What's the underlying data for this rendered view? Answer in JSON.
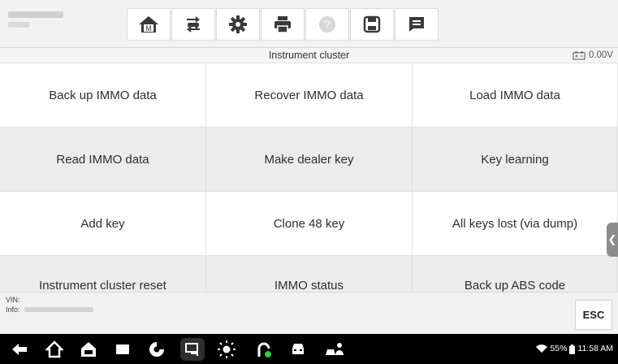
{
  "toolbar": {
    "buttons": [
      {
        "name": "home",
        "icon": "home-icon"
      },
      {
        "name": "vehicle-swap",
        "icon": "vehicle-swap-icon"
      },
      {
        "name": "settings",
        "icon": "gear-icon"
      },
      {
        "name": "print",
        "icon": "printer-icon"
      },
      {
        "name": "help",
        "icon": "help-icon"
      },
      {
        "name": "save",
        "icon": "save-icon"
      },
      {
        "name": "data-logging",
        "icon": "message-icon"
      }
    ],
    "home_badge": "M"
  },
  "titlebar": {
    "title": "Instrument cluster",
    "voltage": "0.00V"
  },
  "functions": [
    "Back up IMMO data",
    "Recover IMMO data",
    "Load IMMO data",
    "Read IMMO data",
    "Make dealer key",
    "Key learning",
    "Add key",
    "Clone 48 key",
    "All keys lost (via dump)",
    "Instrument cluster reset",
    "IMMO status",
    "Back up ABS code"
  ],
  "infobar": {
    "vin_label": "VIN:",
    "info_label": "Info:",
    "esc_label": "ESC"
  },
  "statusbar": {
    "battery": "55%",
    "time": "11:58 AM"
  },
  "colors": {
    "accent": "#ff7a00",
    "navbar": "#000000",
    "cell_shade": "#ececec"
  }
}
